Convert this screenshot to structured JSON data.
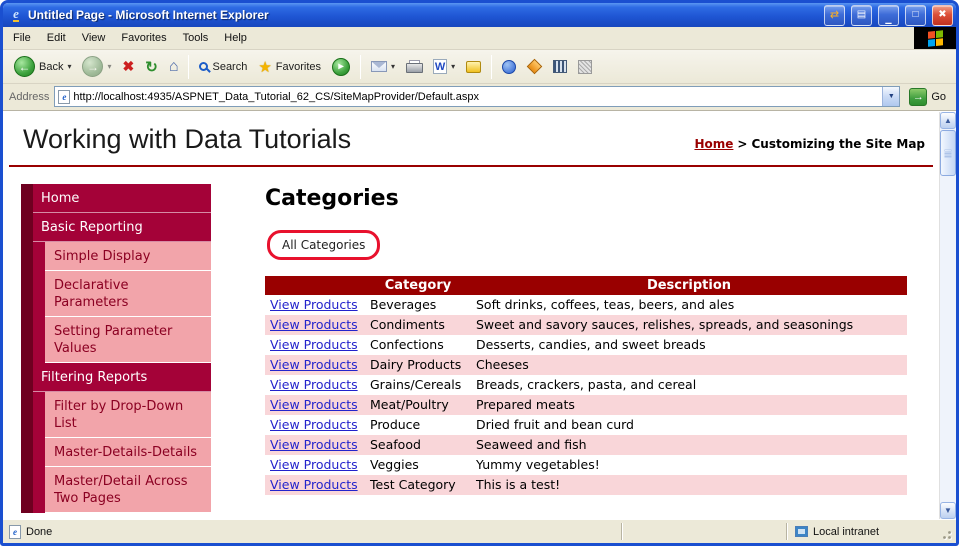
{
  "window": {
    "title": "Untitled Page - Microsoft Internet Explorer",
    "status_left": "Done",
    "status_right": "Local intranet"
  },
  "icons": {
    "ie_e": "e",
    "back_arrow": "←",
    "forward_arrow": "→",
    "stop_x": "✖",
    "refresh": "↻",
    "home": "⌂",
    "star": "★",
    "media_play": "▸",
    "caret": "▾",
    "dropdown": "▼",
    "word_w": "W",
    "go_arrow": "→",
    "scroll_up": "▲",
    "scroll_down": "▼",
    "btn_capture1": "⇄",
    "btn_capture2": "▤",
    "btn_minimize": "▁",
    "btn_maximize": "□",
    "btn_close": "✖"
  },
  "menu": {
    "items": [
      "File",
      "Edit",
      "View",
      "Favorites",
      "Tools",
      "Help"
    ]
  },
  "toolbar": {
    "back_label": "Back",
    "search_label": "Search",
    "favorites_label": "Favorites"
  },
  "address": {
    "label": "Address",
    "url": "http://localhost:4935/ASPNET_Data_Tutorial_62_CS/SiteMapProvider/Default.aspx",
    "go_label": "Go"
  },
  "page": {
    "title": "Working with Data Tutorials",
    "breadcrumb": {
      "home_label": "Home",
      "separator": ">",
      "current": "Customizing the Site Map"
    },
    "sidebar": {
      "items": [
        {
          "label": "Home"
        },
        {
          "label": "Basic Reporting"
        },
        {
          "label": "Simple Display"
        },
        {
          "label": "Declarative Parameters"
        },
        {
          "label": "Setting Parameter Values"
        },
        {
          "label": "Filtering Reports"
        },
        {
          "label": "Filter by Drop-Down List"
        },
        {
          "label": "Master-Details-Details"
        },
        {
          "label": "Master/Detail Across Two Pages"
        }
      ]
    },
    "main": {
      "heading": "Categories",
      "filter_label": "All Categories",
      "table": {
        "headers": {
          "products": "",
          "category": "Category",
          "description": "Description"
        },
        "link_label": "View Products",
        "rows": [
          {
            "category": "Beverages",
            "description": "Soft drinks, coffees, teas, beers, and ales"
          },
          {
            "category": "Condiments",
            "description": "Sweet and savory sauces, relishes, spreads, and seasonings"
          },
          {
            "category": "Confections",
            "description": "Desserts, candies, and sweet breads"
          },
          {
            "category": "Dairy Products",
            "description": "Cheeses"
          },
          {
            "category": "Grains/Cereals",
            "description": "Breads, crackers, pasta, and cereal"
          },
          {
            "category": "Meat/Poultry",
            "description": "Prepared meats"
          },
          {
            "category": "Produce",
            "description": "Dried fruit and bean curd"
          },
          {
            "category": "Seafood",
            "description": "Seaweed and fish"
          },
          {
            "category": "Veggies",
            "description": "Yummy vegetables!"
          },
          {
            "category": "Test Category",
            "description": "This is a test!"
          }
        ]
      }
    }
  },
  "colors": {
    "window_border": "#1A4FD0",
    "titlebar_blue": "#2E6BE4",
    "chrome_bg": "#ECE9D8",
    "maroon": "#990000",
    "sidebar_strip": "#6E0020",
    "sidebar_item_bg": "#A40238",
    "sidebar_sub_bg": "#F2A4AA",
    "sidebar_sub_text": "#8B0022",
    "row_alt_pink": "#F9D6D9",
    "link_blue": "#2323CC",
    "annotation_red": "#E8112D",
    "go_green": "#3F9E3F"
  }
}
